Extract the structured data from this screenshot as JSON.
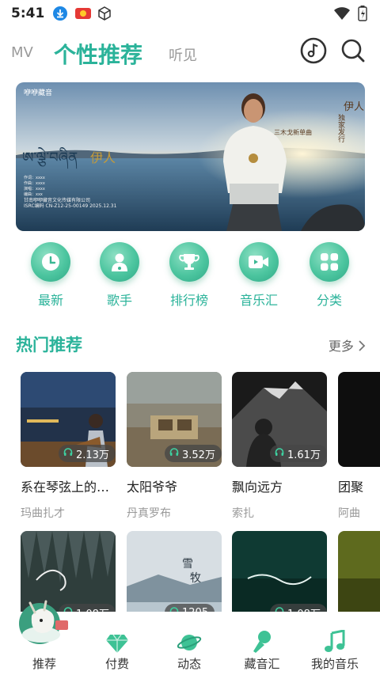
{
  "status_bar": {
    "time": "5:41",
    "icons": [
      "download-icon",
      "app-badge-icon",
      "cube-icon"
    ],
    "right_icons": [
      "wifi-icon",
      "battery-icon"
    ]
  },
  "top_nav": {
    "tabs": [
      {
        "label": "MV",
        "active": false
      },
      {
        "label": "个性推荐",
        "active": true
      },
      {
        "label": "听见",
        "active": false
      }
    ],
    "icons": [
      "music-disc-icon",
      "search-icon"
    ]
  },
  "banner": {
    "logo_text": "咿咿藏音",
    "title_script": "ཨ་ལྕེ་བཞིན",
    "title_cn": "伊人",
    "corner_title": "伊人",
    "corner_sub": "独家发行",
    "tagline": "三木戈新单曲",
    "credits": [
      "作词：xxxx",
      "作曲：xxxx",
      "演唱：xxxx",
      "编曲：xxx",
      "甘南咿咿藏音文化传媒有限公司",
      "ISRC编码 CN-Z12-25-00149 2025.12.31"
    ]
  },
  "quick_links": [
    {
      "label": "最新",
      "icon": "clock-icon"
    },
    {
      "label": "歌手",
      "icon": "singer-icon"
    },
    {
      "label": "排行榜",
      "icon": "trophy-icon"
    },
    {
      "label": "音乐汇",
      "icon": "video-icon"
    },
    {
      "label": "分类",
      "icon": "grid-icon"
    }
  ],
  "section": {
    "title": "热门推荐",
    "more": "更多"
  },
  "cards_row1": [
    {
      "title": "系在琴弦上的…",
      "artist": "玛曲扎才",
      "plays": "2.13万"
    },
    {
      "title": "太阳爷爷",
      "artist": "丹真罗布",
      "plays": "3.52万"
    },
    {
      "title": "飘向远方",
      "artist": "索扎",
      "plays": "1.61万"
    },
    {
      "title": "团聚",
      "artist": "阿曲",
      "plays": ""
    }
  ],
  "cards_row2": [
    {
      "plays": "1.08万"
    },
    {
      "plays": "1205"
    },
    {
      "plays": "1.08万"
    },
    {
      "plays": ""
    }
  ],
  "bottom_nav": [
    {
      "label": "推荐",
      "icon": "recommend-icon",
      "active": true
    },
    {
      "label": "付费",
      "icon": "diamond-icon",
      "active": false
    },
    {
      "label": "动态",
      "icon": "planet-icon",
      "active": false
    },
    {
      "label": "藏音汇",
      "icon": "microphone-icon",
      "active": false
    },
    {
      "label": "我的音乐",
      "icon": "music-note-icon",
      "active": false
    }
  ],
  "colors": {
    "accent": "#2bb39a",
    "inactive_tab": "#9a9a9a"
  }
}
